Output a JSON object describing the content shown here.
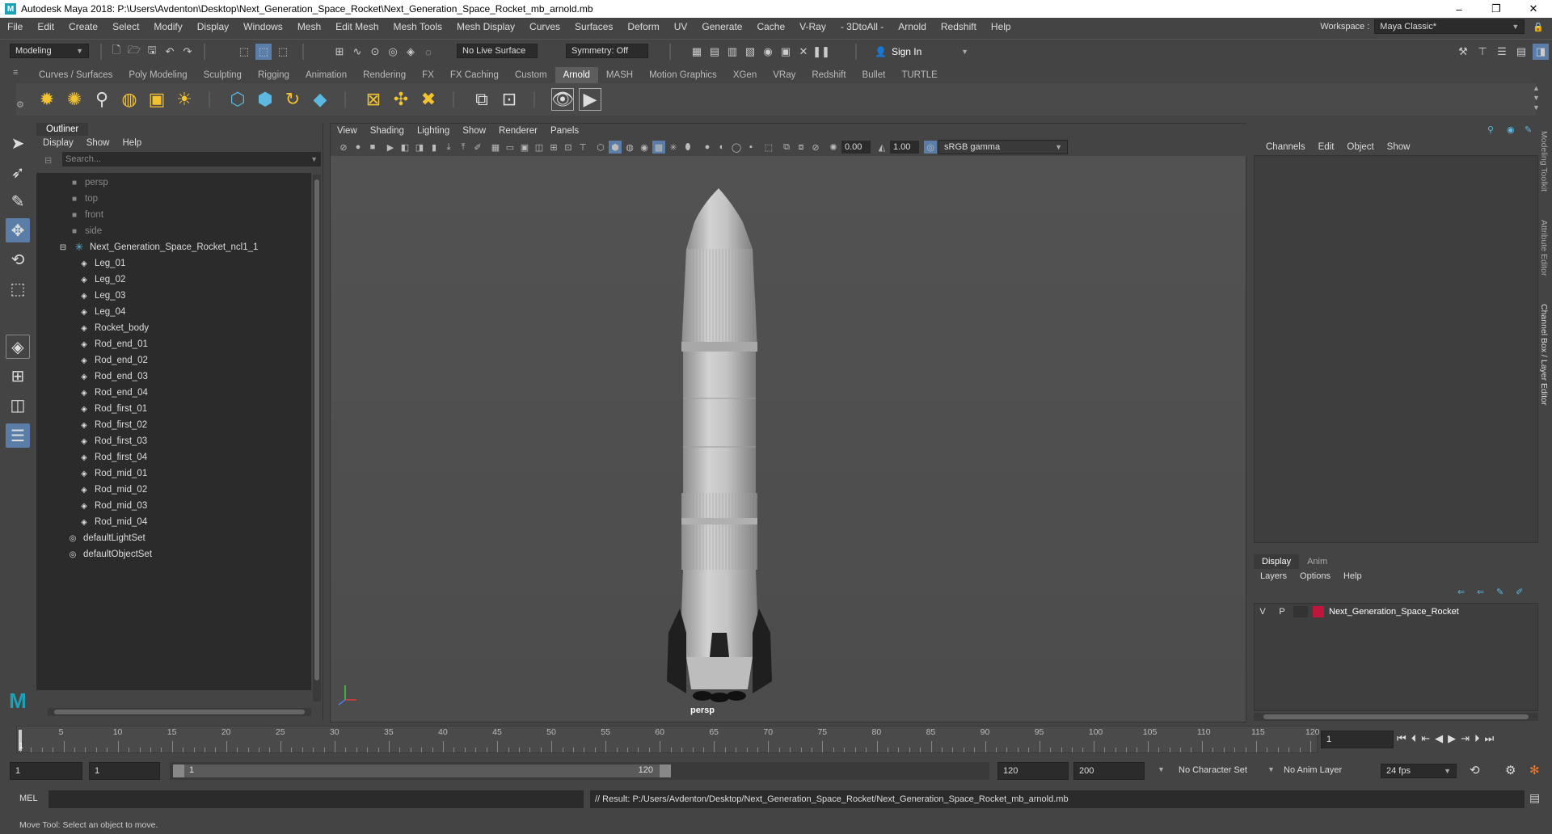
{
  "title": "Autodesk Maya 2018: P:\\Users\\Avdenton\\Desktop\\Next_Generation_Space_Rocket\\Next_Generation_Space_Rocket_mb_arnold.mb",
  "window_buttons": {
    "minimize": "–",
    "restore": "❐",
    "close": "✕"
  },
  "menu": [
    "File",
    "Edit",
    "Create",
    "Select",
    "Modify",
    "Display",
    "Windows",
    "Mesh",
    "Edit Mesh",
    "Mesh Tools",
    "Mesh Display",
    "Curves",
    "Surfaces",
    "Deform",
    "UV",
    "Generate",
    "Cache",
    "V-Ray",
    "- 3DtoAll -",
    "Arnold",
    "Redshift",
    "Help"
  ],
  "workspace": {
    "label": "Workspace :",
    "value": "Maya Classic*"
  },
  "status": {
    "mode": "Modeling",
    "live_surface": "No Live Surface",
    "symmetry": "Symmetry: Off",
    "sign_in": "Sign In"
  },
  "shelf_tabs": [
    "Curves / Surfaces",
    "Poly Modeling",
    "Sculpting",
    "Rigging",
    "Animation",
    "Rendering",
    "FX",
    "FX Caching",
    "Custom",
    "Arnold",
    "MASH",
    "Motion Graphics",
    "XGen",
    "VRay",
    "Redshift",
    "Bullet",
    "TURTLE"
  ],
  "active_shelf": "Arnold",
  "outliner": {
    "title": "Outliner",
    "menu": [
      "Display",
      "Show",
      "Help"
    ],
    "search_placeholder": "Search...",
    "cameras": [
      "persp",
      "top",
      "front",
      "side"
    ],
    "group": "Next_Generation_Space_Rocket_ncl1_1",
    "children": [
      "Leg_01",
      "Leg_02",
      "Leg_03",
      "Leg_04",
      "Rocket_body",
      "Rod_end_01",
      "Rod_end_02",
      "Rod_end_03",
      "Rod_end_04",
      "Rod_first_01",
      "Rod_first_02",
      "Rod_first_03",
      "Rod_first_04",
      "Rod_mid_01",
      "Rod_mid_02",
      "Rod_mid_03",
      "Rod_mid_04"
    ],
    "sets": [
      "defaultLightSet",
      "defaultObjectSet"
    ]
  },
  "viewport": {
    "menu": [
      "View",
      "Shading",
      "Lighting",
      "Show",
      "Renderer",
      "Panels"
    ],
    "exposure": "0.00",
    "gamma": "1.00",
    "color_space": "sRGB gamma",
    "camera_label": "persp"
  },
  "channel_box": {
    "menu": [
      "Channels",
      "Edit",
      "Object",
      "Show"
    ]
  },
  "layer_editor": {
    "tabs": [
      "Display",
      "Anim"
    ],
    "menu": [
      "Layers",
      "Options",
      "Help"
    ],
    "layer": {
      "v": "V",
      "p": "P",
      "name": "Next_Generation_Space_Rocket",
      "color": "#c0163c"
    }
  },
  "side_tabs": [
    "Modeling Toolkit",
    "Attribute Editor",
    "Channel Box / Layer Editor"
  ],
  "timeline": {
    "ticks": [
      "5",
      "10",
      "15",
      "20",
      "25",
      "30",
      "35",
      "40",
      "45",
      "50",
      "55",
      "60",
      "65",
      "70",
      "75",
      "80",
      "85",
      "90",
      "95",
      "100",
      "105",
      "110",
      "115",
      "120"
    ],
    "first_tick": "1",
    "current_frame": "1"
  },
  "range": {
    "start": "1",
    "playback_start": "1",
    "slider_start": "1",
    "slider_end": "120",
    "playback_end": "120",
    "end": "200",
    "character_set": "No Character Set",
    "anim_layer": "No Anim Layer",
    "fps": "24 fps"
  },
  "command": {
    "lang": "MEL",
    "result": "// Result: P:/Users/Avdenton/Desktop/Next_Generation_Space_Rocket/Next_Generation_Space_Rocket_mb_arnold.mb"
  },
  "help_line": "Move Tool: Select an object to move."
}
